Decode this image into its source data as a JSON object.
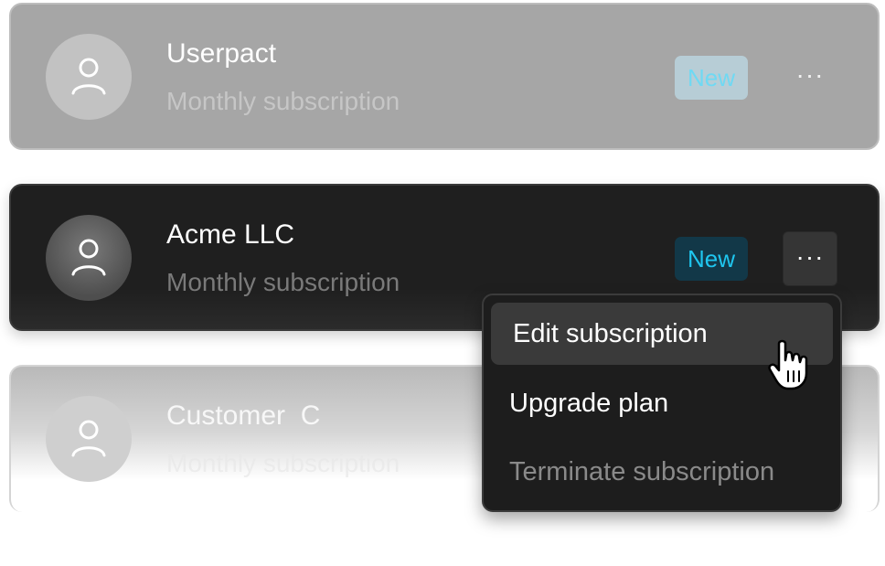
{
  "subscriptions": [
    {
      "name": "Userpact",
      "plan": "Monthly subscription",
      "badge": "New",
      "more_label": "···"
    },
    {
      "name": "Acme LLC",
      "plan": "Monthly subscription",
      "badge": "New",
      "more_label": "···"
    },
    {
      "name": "Customer  C",
      "plan": "Monthly subscription"
    }
  ],
  "context_menu": {
    "items": [
      "Edit subscription",
      "Upgrade plan",
      "Terminate subscription"
    ]
  },
  "icons": {
    "avatar": "user-icon",
    "more": "more-horizontal-icon",
    "cursor": "hand-pointer-icon"
  },
  "colors": {
    "badge_text": "#1fc6ef",
    "active_card": "#1f1f1f",
    "menu_bg": "#1d1d1d",
    "disabled_text": "#8a8a8a"
  }
}
